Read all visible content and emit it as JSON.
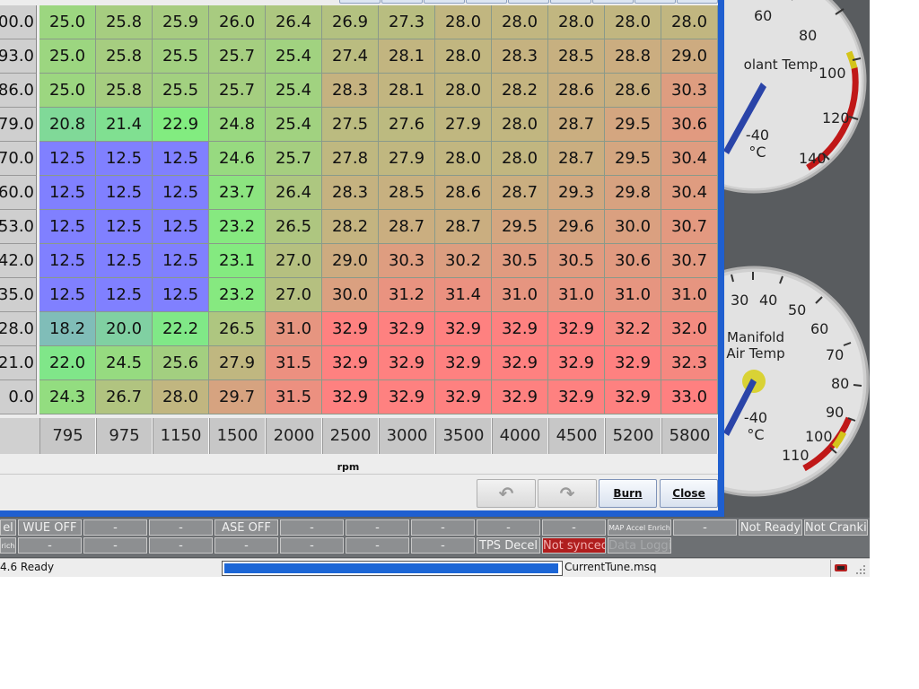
{
  "ve_table": {
    "y_labels": [
      "00.0",
      "93.0",
      "86.0",
      "79.0",
      "70.0",
      "60.0",
      "53.0",
      "42.0",
      "35.0",
      "28.0",
      "21.0",
      "0.0"
    ],
    "rpm_bins": [
      "795",
      "975",
      "1150",
      "1500",
      "2000",
      "2500",
      "3000",
      "3500",
      "4000",
      "4500",
      "5200",
      "5800"
    ],
    "x_axis_label": "rpm",
    "rows": [
      [
        "25.0",
        "25.8",
        "25.9",
        "26.0",
        "26.4",
        "26.9",
        "27.3",
        "28.0",
        "28.0",
        "28.0",
        "28.0",
        "28.0"
      ],
      [
        "25.0",
        "25.8",
        "25.5",
        "25.7",
        "25.4",
        "27.4",
        "28.1",
        "28.0",
        "28.3",
        "28.5",
        "28.8",
        "29.0"
      ],
      [
        "25.0",
        "25.8",
        "25.5",
        "25.7",
        "25.4",
        "28.3",
        "28.1",
        "28.0",
        "28.2",
        "28.6",
        "28.6",
        "30.3"
      ],
      [
        "20.8",
        "21.4",
        "22.9",
        "24.8",
        "25.4",
        "27.5",
        "27.6",
        "27.9",
        "28.0",
        "28.7",
        "29.5",
        "30.6"
      ],
      [
        "12.5",
        "12.5",
        "12.5",
        "24.6",
        "25.7",
        "27.8",
        "27.9",
        "28.0",
        "28.0",
        "28.7",
        "29.5",
        "30.4"
      ],
      [
        "12.5",
        "12.5",
        "12.5",
        "23.7",
        "26.4",
        "28.3",
        "28.5",
        "28.6",
        "28.7",
        "29.3",
        "29.8",
        "30.4"
      ],
      [
        "12.5",
        "12.5",
        "12.5",
        "23.2",
        "26.5",
        "28.2",
        "28.7",
        "28.7",
        "29.5",
        "29.6",
        "30.0",
        "30.7"
      ],
      [
        "12.5",
        "12.5",
        "12.5",
        "23.1",
        "27.0",
        "29.0",
        "30.3",
        "30.2",
        "30.5",
        "30.5",
        "30.6",
        "30.7"
      ],
      [
        "12.5",
        "12.5",
        "12.5",
        "23.2",
        "27.0",
        "30.0",
        "31.2",
        "31.4",
        "31.0",
        "31.0",
        "31.0",
        "31.0"
      ],
      [
        "18.2",
        "20.0",
        "22.2",
        "26.5",
        "31.0",
        "32.9",
        "32.9",
        "32.9",
        "32.9",
        "32.9",
        "32.2",
        "32.0"
      ],
      [
        "22.0",
        "24.5",
        "25.6",
        "27.9",
        "31.5",
        "32.9",
        "32.9",
        "32.9",
        "32.9",
        "32.9",
        "32.9",
        "32.3"
      ],
      [
        "24.3",
        "26.7",
        "28.0",
        "29.7",
        "31.5",
        "32.9",
        "32.9",
        "32.9",
        "32.9",
        "32.9",
        "32.9",
        "33.0"
      ]
    ],
    "color_scale": {
      "low": "#8080ff",
      "mid": "#80ee80",
      "high": "#ff8080",
      "min": 12.5,
      "max": 33.0
    }
  },
  "buttons": {
    "undo_icon": "undo-icon",
    "redo_icon": "redo-icon",
    "burn_label": "Burn",
    "close_label": "Close"
  },
  "gauges": {
    "coolant": {
      "title": "olant Temp",
      "unit_value": "-40",
      "unit": "°C",
      "ticks": [
        "60",
        "80",
        "100",
        "120",
        "140"
      ],
      "needle_value": -40,
      "colors": {
        "face": "#dedede",
        "rim": "#bfbfbf",
        "red_zone": "#c01818",
        "yellow_zone": "#d4c41a",
        "needle": "#2a44a8"
      }
    },
    "mat": {
      "title_line1": "Manifold",
      "title_line2": "Air Temp",
      "unit_value": "-40",
      "unit": "°C",
      "ticks": [
        "30",
        "40",
        "50",
        "60",
        "70",
        "80",
        "90",
        "100",
        "110"
      ],
      "needle_value": -40
    }
  },
  "indicators": {
    "row1": [
      "el",
      "WUE OFF",
      "-",
      "-",
      "ASE OFF",
      "-",
      "-",
      "-",
      "-",
      "-",
      "MAP Accel Enrich",
      "-",
      "Not Ready",
      "Not Cranking"
    ],
    "row2": [
      "rich",
      "-",
      "-",
      "-",
      "-",
      "-",
      "-",
      "-",
      "TPS Decel",
      "Not synced",
      "Data Logging"
    ]
  },
  "statusbar": {
    "status": "4.6 Ready",
    "progress": 1.0,
    "file": "CurrentTune.msq",
    "net_icon": "network-icon",
    "grip_icon": "resize-grip-icon"
  }
}
